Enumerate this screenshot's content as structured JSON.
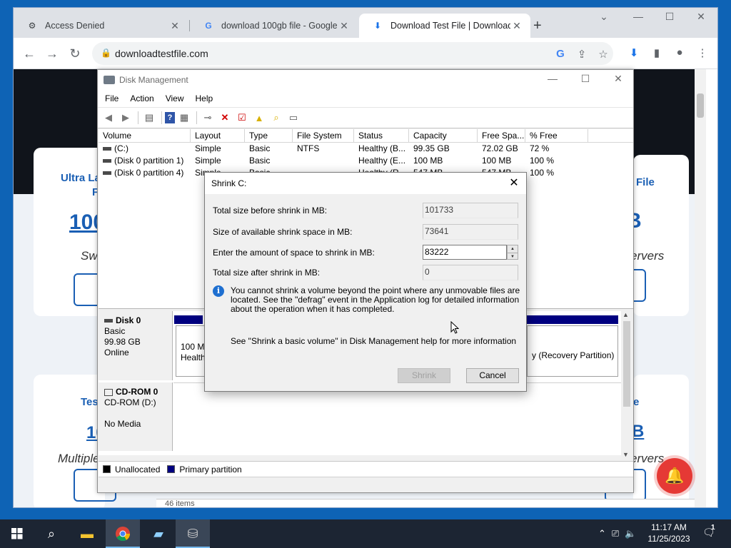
{
  "browser": {
    "tabs": [
      {
        "label": "Access Denied",
        "active": false
      },
      {
        "label": "download 100gb file - Google Se",
        "active": false
      },
      {
        "label": "Download Test File | Download T",
        "active": true
      }
    ],
    "url": "downloadtestfile.com"
  },
  "page_behind": {
    "left_card_title_1": "Ultra La",
    "left_card_title_2": "F",
    "left_card_big": "100",
    "left_card_sub": "Swe",
    "right_card_title": "File",
    "right_card_big": "B",
    "right_card_sub": "ervers",
    "left_card2_title": "Test",
    "left_card2_big": "10",
    "left_card2_sub": "Multiple",
    "right_card2_title": "e",
    "right_card2_big": "B",
    "right_card2_sub": "ervers",
    "bottom_text": "46 items"
  },
  "disk_management": {
    "title": "Disk Management",
    "menu": [
      "File",
      "Action",
      "View",
      "Help"
    ],
    "columns": [
      "Volume",
      "Layout",
      "Type",
      "File System",
      "Status",
      "Capacity",
      "Free Spa...",
      "% Free"
    ],
    "rows": [
      [
        "(C:)",
        "Simple",
        "Basic",
        "NTFS",
        "Healthy (B...",
        "99.35 GB",
        "72.02 GB",
        "72 %"
      ],
      [
        "(Disk 0 partition 1)",
        "Simple",
        "Basic",
        "",
        "Healthy (E...",
        "100 MB",
        "100 MB",
        "100 %"
      ],
      [
        "(Disk 0 partition 4)",
        "Simple",
        "Basic",
        "",
        "Healthy (R...",
        "547 MB",
        "547 MB",
        "100 %"
      ]
    ],
    "disk0": {
      "name": "Disk 0",
      "type": "Basic",
      "size": "99.98 GB",
      "status": "Online"
    },
    "disk0_partition_left": {
      "line1": "100 MB",
      "line2": "Healthy"
    },
    "disk0_partition_right": "y (Recovery Partition)",
    "cdrom": {
      "name": "CD-ROM 0",
      "label": "CD-ROM (D:)",
      "status": "No Media"
    },
    "legend": [
      {
        "label": "Unallocated",
        "color": "#000000"
      },
      {
        "label": "Primary partition",
        "color": "#000080"
      }
    ]
  },
  "shrink_dialog": {
    "title": "Shrink C:",
    "total_before_label": "Total size before shrink in MB:",
    "total_before_value": "101733",
    "available_label": "Size of available shrink space in MB:",
    "available_value": "73641",
    "amount_label": "Enter the amount of space to shrink in MB:",
    "amount_value": "83222",
    "after_label": "Total size after shrink in MB:",
    "after_value": "0",
    "info_text": "You cannot shrink a volume beyond the point where any unmovable files are located. See the \"defrag\" event in the Application log for detailed information about the operation when it has completed.",
    "help_text": "See \"Shrink a basic volume\" in Disk Management help for more information",
    "shrink_button": "Shrink",
    "cancel_button": "Cancel"
  },
  "taskbar": {
    "time": "11:17 AM",
    "date": "11/25/2023",
    "notification_count": "1"
  },
  "colors": {
    "accent": "#1a5fb4",
    "partition_primary": "#000080",
    "bell": "#e53935",
    "taskbar": "#1c2533"
  }
}
